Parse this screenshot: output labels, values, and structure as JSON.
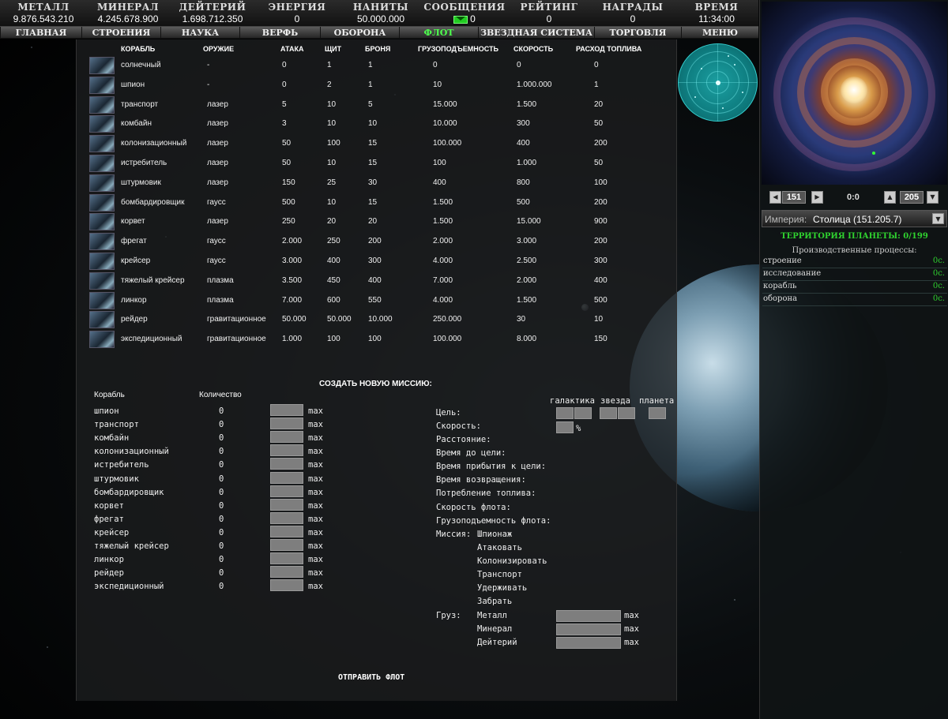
{
  "resources": [
    {
      "label": "МЕТАЛЛ",
      "value": "9.876.543.210"
    },
    {
      "label": "МИНЕРАЛ",
      "value": "4.245.678.900"
    },
    {
      "label": "ДЕЙТЕРИЙ",
      "value": "1.698.712.350"
    },
    {
      "label": "ЭНЕРГИЯ",
      "value": "0"
    },
    {
      "label": "НАНИТЫ",
      "value": "50.000.000"
    },
    {
      "label": "СООБЩЕНИЯ",
      "value": "0"
    },
    {
      "label": "РЕЙТИНГ",
      "value": "0"
    },
    {
      "label": "НАГРАДЫ",
      "value": "0"
    },
    {
      "label": "ВРЕМЯ",
      "value": "11:34:00"
    }
  ],
  "nav": [
    "ГЛАВНАЯ",
    "СТРОЕНИЯ",
    "НАУКА",
    "ВЕРФЬ",
    "ОБОРОНА",
    "ФЛОТ",
    "ЗВЕЗДНАЯ СИСТЕМА",
    "ТОРГОВЛЯ",
    "МЕНЮ"
  ],
  "nav_active": "ФЛОТ",
  "colors": {
    "active": "#4dff4d",
    "green_text": "#2fd12f",
    "panel": "#1c1e1f"
  },
  "ship_table": {
    "headers": [
      "КОРАБЛЬ",
      "ОРУЖИЕ",
      "АТАКА",
      "ЩИТ",
      "БРОНЯ",
      "ГРУЗОПОДЪЕМНОСТЬ",
      "СКОРОСТЬ",
      "РАСХОД ТОПЛИВА"
    ],
    "rows": [
      [
        "солнечный",
        "-",
        "0",
        "1",
        "1",
        "0",
        "0",
        "0"
      ],
      [
        "шпион",
        "-",
        "0",
        "2",
        "1",
        "10",
        "1.000.000",
        "1"
      ],
      [
        "транспорт",
        "лазер",
        "5",
        "10",
        "5",
        "15.000",
        "1.500",
        "20"
      ],
      [
        "комбайн",
        "лазер",
        "3",
        "10",
        "10",
        "10.000",
        "300",
        "50"
      ],
      [
        "колонизационный",
        "лазер",
        "50",
        "100",
        "15",
        "100.000",
        "400",
        "200"
      ],
      [
        "истребитель",
        "лазер",
        "50",
        "10",
        "15",
        "100",
        "1.000",
        "50"
      ],
      [
        "штурмовик",
        "лазер",
        "150",
        "25",
        "30",
        "400",
        "800",
        "100"
      ],
      [
        "бомбардировщик",
        "гаусс",
        "500",
        "10",
        "15",
        "1.500",
        "500",
        "200"
      ],
      [
        "корвет",
        "лазер",
        "250",
        "20",
        "20",
        "1.500",
        "15.000",
        "900"
      ],
      [
        "фрегат",
        "гаусс",
        "2.000",
        "250",
        "200",
        "2.000",
        "3.000",
        "200"
      ],
      [
        "крейсер",
        "гаусс",
        "3.000",
        "400",
        "300",
        "4.000",
        "2.500",
        "300"
      ],
      [
        "тяжелый крейсер",
        "плазма",
        "3.500",
        "450",
        "400",
        "7.000",
        "2.000",
        "400"
      ],
      [
        "линкор",
        "плазма",
        "7.000",
        "600",
        "550",
        "4.000",
        "1.500",
        "500"
      ],
      [
        "рейдер",
        "гравитационное",
        "50.000",
        "50.000",
        "10.000",
        "250.000",
        "30",
        "10"
      ],
      [
        "экспедиционный",
        "гравитационное",
        "1.000",
        "100",
        "100",
        "100.000",
        "8.000",
        "150"
      ]
    ]
  },
  "mission": {
    "title": "СОЗДАТЬ НОВУЮ МИССИЮ:",
    "col_ship": "Корабль",
    "col_qty": "Количество",
    "max_label": "max",
    "ships": [
      {
        "name": "шпион",
        "qty": "0"
      },
      {
        "name": "транспорт",
        "qty": "0"
      },
      {
        "name": "комбайн",
        "qty": "0"
      },
      {
        "name": "колонизационный",
        "qty": "0"
      },
      {
        "name": "истребитель",
        "qty": "0"
      },
      {
        "name": "штурмовик",
        "qty": "0"
      },
      {
        "name": "бомбардировщик",
        "qty": "0"
      },
      {
        "name": "корвет",
        "qty": "0"
      },
      {
        "name": "фрегат",
        "qty": "0"
      },
      {
        "name": "крейсер",
        "qty": "0"
      },
      {
        "name": "тяжелый крейсер",
        "qty": "0"
      },
      {
        "name": "линкор",
        "qty": "0"
      },
      {
        "name": "рейдер",
        "qty": "0"
      },
      {
        "name": "экспедиционный",
        "qty": "0"
      }
    ],
    "coord_headers": [
      "галактика",
      "звезда",
      "планета"
    ],
    "target_label": "Цель:",
    "speed_label": "Скорость:",
    "speed_unit": "%",
    "info_labels": [
      "Расстояние:",
      "Время до цели:",
      "Время прибытия к цели:",
      "Время возвращения:",
      "Потребление топлива:",
      "Скорость флота:",
      "Грузоподъемность флота:"
    ],
    "mission_label": "Миссия:",
    "missions": [
      "Шпионаж",
      "Атаковать",
      "Колонизировать",
      "Транспорт",
      "Удерживать",
      "Забрать"
    ],
    "cargo_label": "Груз:",
    "cargo": [
      "Металл",
      "Минерал",
      "Дейтерий"
    ],
    "send": "ОТПРАВИТЬ ФЛОТ"
  },
  "right": {
    "galaxy": "151",
    "center": "0:0",
    "system": "205",
    "empire_label": "Империя:",
    "empire_value": "Столица (151.205.7)",
    "territory": "ТЕРРИТОРИЯ ПЛАНЕТЫ: 0/199",
    "production_header": "Производственные процессы:",
    "processes": [
      {
        "name": "строение",
        "time": "0с."
      },
      {
        "name": "исследование",
        "time": "0с."
      },
      {
        "name": "корабль",
        "time": "0с."
      },
      {
        "name": "оборона",
        "time": "0с."
      }
    ]
  }
}
